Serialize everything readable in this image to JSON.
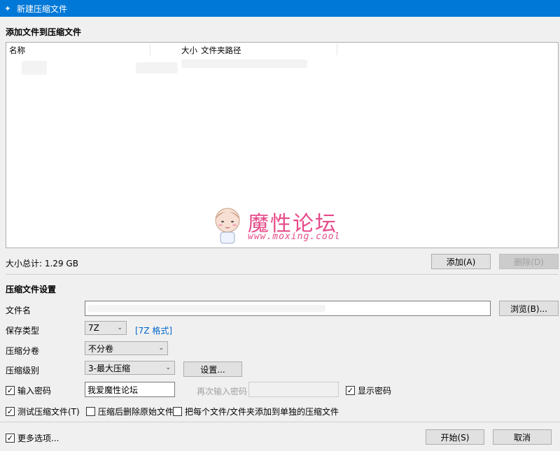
{
  "window": {
    "title": "新建压缩文件"
  },
  "add_section": {
    "title": "添加文件到压缩文件",
    "columns": {
      "name": "名称",
      "size": "大小",
      "path": "文件夹路径"
    }
  },
  "watermark": {
    "title": "魔性论坛",
    "url": "www.moxing.cool"
  },
  "summary": {
    "size_total": "大小总计: 1.29 GB"
  },
  "buttons": {
    "add": "添加(A)",
    "delete": "删除(D)",
    "browse": "浏览(B)...",
    "settings": "设置...",
    "start": "开始(S)",
    "cancel": "取消"
  },
  "settings_section": {
    "title": "压缩文件设置",
    "filename_label": "文件名",
    "save_type_label": "保存类型",
    "save_type_value": "7Z",
    "format_link": "[7Z 格式]",
    "split_label": "压缩分卷",
    "split_value": "不分卷",
    "level_label": "压缩级别",
    "level_value": "3-最大压缩",
    "password_checkbox": "输入密码",
    "password_value": "我爱魔性论坛",
    "reenter_password_label": "再次输入密码",
    "show_password": "显示密码",
    "test_archive": "测试压缩文件(T)",
    "delete_after": "压缩后删除原始文件",
    "each_separate": "把每个文件/文件夹添加到单独的压缩文件",
    "more_options": "更多选项..."
  },
  "checkbox_states": {
    "password": true,
    "show_password": true,
    "test_archive": true,
    "delete_after": false,
    "each_separate": false,
    "more_options": true
  },
  "colors": {
    "titlebar": "#0078d7",
    "link": "#0066cc",
    "watermark": "#e64b8a"
  }
}
